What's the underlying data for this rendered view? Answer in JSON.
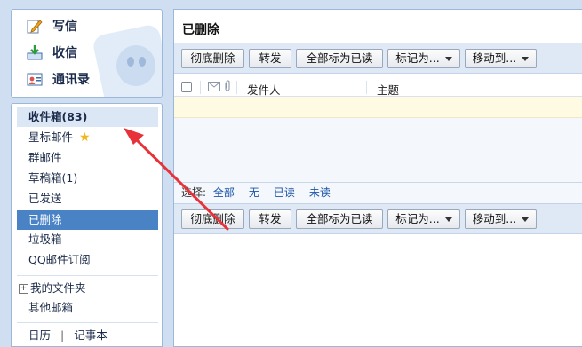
{
  "compose": {
    "write_label": "写信",
    "receive_label": "收信",
    "contacts_label": "通讯录"
  },
  "folders": {
    "inbox": "收件箱(83)",
    "starred": "星标邮件",
    "group": "群邮件",
    "drafts": "草稿箱(1)",
    "sent": "已发送",
    "deleted": "已删除",
    "spam": "垃圾箱",
    "qq_subscription": "QQ邮件订阅",
    "my_folders": "我的文件夹",
    "other_mailboxes": "其他邮箱",
    "calendar": "日历",
    "divider": "|",
    "notes": "记事本"
  },
  "main": {
    "title": "已删除",
    "buttons": {
      "delete_permanently": "彻底删除",
      "forward": "转发",
      "mark_all_read": "全部标为已读",
      "mark_as": "标记为...",
      "move_to": "移动到..."
    },
    "columns": {
      "sender": "发件人",
      "subject": "主题"
    },
    "select": {
      "label": "选择:",
      "all": "全部",
      "none": "无",
      "read": "已读",
      "unread": "未读",
      "dash": "-"
    }
  },
  "colors": {
    "active_folder": "#4a82c6",
    "panel_border": "#9bb7d9",
    "arrow": "#e8323a"
  }
}
